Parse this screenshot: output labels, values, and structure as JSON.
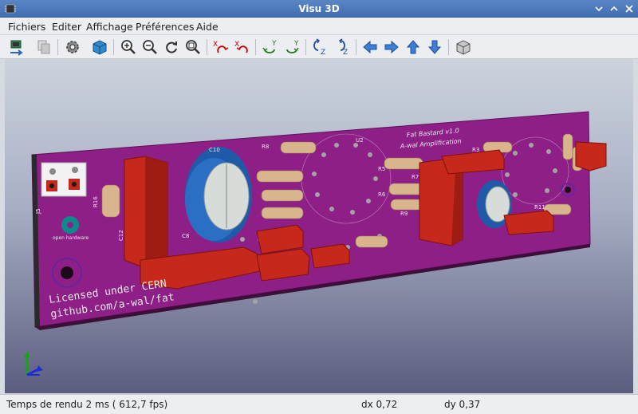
{
  "window": {
    "title": "Visu 3D"
  },
  "menu": {
    "items": [
      "Fichiers",
      "Editer",
      "Affichage",
      "Préférences",
      "Aide"
    ]
  },
  "toolbar": {
    "icons": [
      "copy-to-pcbnew-icon",
      "copy-image-icon",
      "settings-gear-icon",
      "render-cube-icon",
      "zoom-in-icon",
      "zoom-out-icon",
      "redraw-icon",
      "zoom-fit-icon",
      "rotate-x-cw-icon",
      "rotate-x-ccw-icon",
      "rotate-y-cw-icon",
      "rotate-y-ccw-icon",
      "rotate-z-cw-icon",
      "rotate-z-ccw-icon",
      "move-left-icon",
      "move-right-icon",
      "move-up-icon",
      "move-down-icon",
      "ortho-view-icon"
    ]
  },
  "board": {
    "title": "Fat Bastard v1.0",
    "subtitle": "A-wal Amplification",
    "license_line1": "Licensed under CERN",
    "license_line2": "github.com/a-wal/fat",
    "logo_text": "open hardware",
    "labels": [
      "R16",
      "C12",
      "J5",
      "C10",
      "R8",
      "U2",
      "R5",
      "R7",
      "R3",
      "R6",
      "R9",
      "R11",
      "C8"
    ],
    "colors": {
      "pcb": "#8e1f86",
      "capacitor_blue": "#1f5aa8",
      "component_red": "#c6281c",
      "resistor_tan": "#d8b58c"
    }
  },
  "status": {
    "render_time": "Temps de rendu 2 ms ( 612,7 fps)",
    "dx": "dx 0,72",
    "dy": "dy 0,37"
  }
}
